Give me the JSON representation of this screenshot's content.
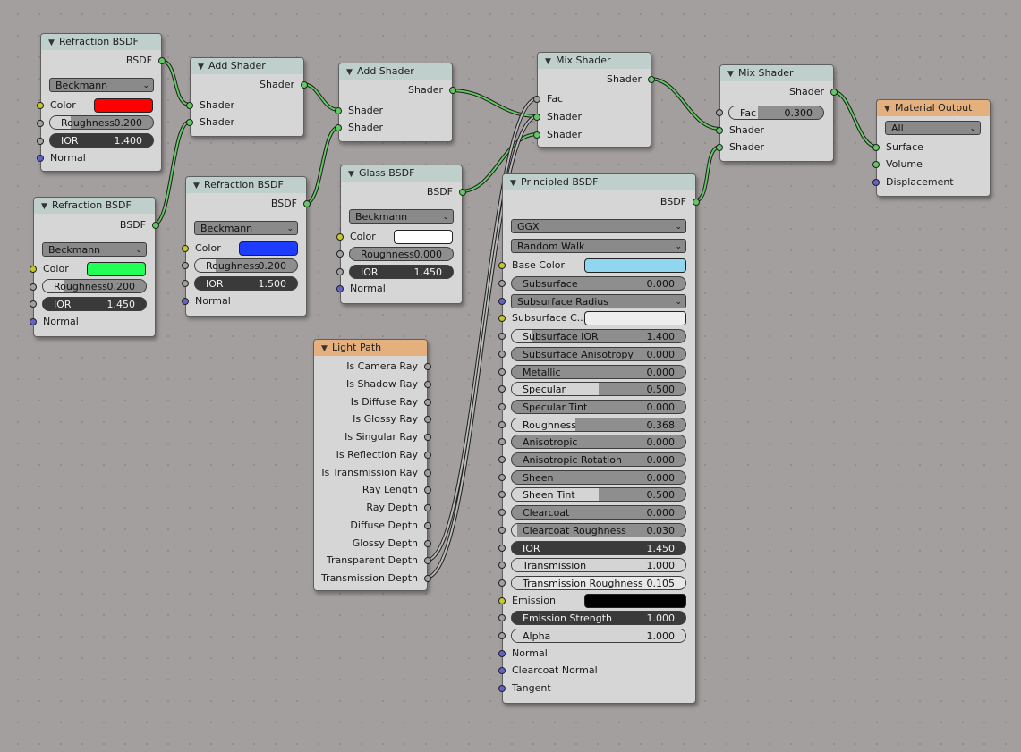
{
  "colors": {
    "red": "#ff0000",
    "blue": "#1e3cff",
    "green": "#22ff55",
    "white": "#ffffff",
    "base_color": "#8fd6ee",
    "subsurface_color": "#eeeeee",
    "emission": "#000000",
    "shader_socket": "#63c763",
    "color_socket": "#c7c729",
    "float_socket": "#a1a1a1",
    "vector_socket": "#6363c7"
  },
  "refraction1": {
    "title": "Refraction BSDF",
    "output": "BSDF",
    "distribution": "Beckmann",
    "color_label": "Color",
    "roughness_label": "Roughness",
    "roughness": "0.200",
    "roughness_frac": 0.2,
    "ior_label": "IOR",
    "ior": "1.400",
    "normal_label": "Normal"
  },
  "refraction2": {
    "title": "Refraction BSDF",
    "output": "BSDF",
    "distribution": "Beckmann",
    "color_label": "Color",
    "roughness_label": "Roughness",
    "roughness": "0.200",
    "roughness_frac": 0.2,
    "ior_label": "IOR",
    "ior": "1.450",
    "normal_label": "Normal"
  },
  "refraction3": {
    "title": "Refraction BSDF",
    "output": "BSDF",
    "distribution": "Beckmann",
    "color_label": "Color",
    "roughness_label": "Roughness",
    "roughness": "0.200",
    "roughness_frac": 0.2,
    "ior_label": "IOR",
    "ior": "1.500",
    "normal_label": "Normal"
  },
  "add1": {
    "title": "Add Shader",
    "output": "Shader",
    "in1": "Shader",
    "in2": "Shader"
  },
  "add2": {
    "title": "Add Shader",
    "output": "Shader",
    "in1": "Shader",
    "in2": "Shader"
  },
  "glass": {
    "title": "Glass BSDF",
    "output": "BSDF",
    "distribution": "Beckmann",
    "color_label": "Color",
    "roughness_label": "Roughness",
    "roughness": "0.000",
    "roughness_frac": 0,
    "ior_label": "IOR",
    "ior": "1.450",
    "normal_label": "Normal"
  },
  "mix1": {
    "title": "Mix Shader",
    "output": "Shader",
    "fac_label": "Fac",
    "in1": "Shader",
    "in2": "Shader"
  },
  "mix2": {
    "title": "Mix Shader",
    "output": "Shader",
    "fac_label": "Fac",
    "fac": "0.300",
    "fac_frac": 0.3,
    "in1": "Shader",
    "in2": "Shader"
  },
  "output": {
    "title": "Material Output",
    "target": "All",
    "surface": "Surface",
    "volume": "Volume",
    "displacement": "Displacement"
  },
  "lightpath": {
    "title": "Light Path",
    "outputs": [
      "Is Camera Ray",
      "Is Shadow Ray",
      "Is Diffuse Ray",
      "Is Glossy Ray",
      "Is Singular Ray",
      "Is Reflection Ray",
      "Is Transmission Ray",
      "Ray Length",
      "Ray Depth",
      "Diffuse Depth",
      "Glossy Depth",
      "Transparent Depth",
      "Transmission Depth"
    ]
  },
  "principled": {
    "title": "Principled BSDF",
    "output": "BSDF",
    "distribution": "GGX",
    "subsurface_method": "Random Walk",
    "base_color_label": "Base Color",
    "subsurface_radius_label": "Subsurface Radius",
    "subsurface_color_label": "Subsurface C...",
    "emission_label": "Emission",
    "params": [
      {
        "label": "Subsurface",
        "value": "0.000",
        "frac": 0,
        "style": "normal"
      },
      {
        "label": "Subsurface IOR",
        "value": "1.400",
        "frac": 0.12,
        "style": "normal"
      },
      {
        "label": "Subsurface Anisotropy",
        "value": "0.000",
        "frac": 0,
        "style": "normal"
      },
      {
        "label": "Metallic",
        "value": "0.000",
        "frac": 0,
        "style": "normal"
      },
      {
        "label": "Specular",
        "value": "0.500",
        "frac": 0.5,
        "style": "normal"
      },
      {
        "label": "Specular Tint",
        "value": "0.000",
        "frac": 0,
        "style": "normal"
      },
      {
        "label": "Roughness",
        "value": "0.368",
        "frac": 0.368,
        "style": "normal"
      },
      {
        "label": "Anisotropic",
        "value": "0.000",
        "frac": 0,
        "style": "normal"
      },
      {
        "label": "Anisotropic Rotation",
        "value": "0.000",
        "frac": 0,
        "style": "normal"
      },
      {
        "label": "Sheen",
        "value": "0.000",
        "frac": 0,
        "style": "normal"
      },
      {
        "label": "Sheen Tint",
        "value": "0.500",
        "frac": 0.5,
        "style": "normal"
      },
      {
        "label": "Clearcoat",
        "value": "0.000",
        "frac": 0,
        "style": "normal"
      },
      {
        "label": "Clearcoat Roughness",
        "value": "0.030",
        "frac": 0.03,
        "style": "normal"
      }
    ],
    "ior_label": "IOR",
    "ior": "1.450",
    "transmission_label": "Transmission",
    "transmission": "1.000",
    "transmission_roughness_label": "Transmission Roughness",
    "transmission_roughness": "0.105",
    "emission_strength_label": "Emission Strength",
    "emission_strength": "1.000",
    "alpha_label": "Alpha",
    "alpha": "1.000",
    "normal_label": "Normal",
    "clearcoat_normal_label": "Clearcoat Normal",
    "tangent_label": "Tangent"
  }
}
